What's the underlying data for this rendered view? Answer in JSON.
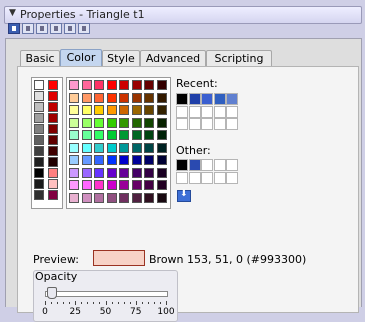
{
  "window": {
    "title": "Properties - Triangle t1"
  },
  "toolbar_icons": [
    "properties-view-icon",
    "triangle-icon",
    "grid-icon",
    "image-icon",
    "align-icon",
    "brush-icon"
  ],
  "tabs": [
    {
      "label": "Basic",
      "active": false
    },
    {
      "label": "Color",
      "active": true
    },
    {
      "label": "Style",
      "active": false
    },
    {
      "label": "Advanced",
      "active": false
    },
    {
      "label": "Scripting",
      "active": false
    }
  ],
  "palette": {
    "recent_label": "Recent:",
    "other_label": "Other:",
    "gray_column": [
      "#ffffff",
      "#e0e0e0",
      "#c0c0c0",
      "#a0a0a0",
      "#808080",
      "#606060",
      "#404040",
      "#202020",
      "#000000",
      "#1a1a1a",
      "#303030"
    ],
    "red_column": [
      "#ff0000",
      "#e00000",
      "#c00000",
      "#a00000",
      "#800000",
      "#600000",
      "#400000",
      "#200000",
      "#ff8080",
      "#ffc0c0",
      "#800040"
    ],
    "grid_colors": [
      [
        "#ff99cc",
        "#ff6699",
        "#ff3366",
        "#ff0000",
        "#cc0000",
        "#990000",
        "#660000",
        "#330000"
      ],
      [
        "#ffcc99",
        "#ff9966",
        "#ff6633",
        "#ff3300",
        "#cc3300",
        "#993300",
        "#663300",
        "#331a00"
      ],
      [
        "#ffff99",
        "#ffff66",
        "#ffcc00",
        "#ff9900",
        "#cc6600",
        "#996600",
        "#664400",
        "#332200"
      ],
      [
        "#ccff99",
        "#99ff66",
        "#66ff33",
        "#33cc00",
        "#339900",
        "#226600",
        "#114400",
        "#082200"
      ],
      [
        "#99ffcc",
        "#66ff99",
        "#33ff66",
        "#00cc33",
        "#009933",
        "#006622",
        "#004411",
        "#002208"
      ],
      [
        "#99ffff",
        "#66ffff",
        "#33cccc",
        "#00cccc",
        "#009999",
        "#006666",
        "#004444",
        "#002222"
      ],
      [
        "#99ccff",
        "#6699ff",
        "#3366ff",
        "#0033ff",
        "#0000cc",
        "#000099",
        "#000066",
        "#000033"
      ],
      [
        "#cc99ff",
        "#9966ff",
        "#6633ff",
        "#6600cc",
        "#660099",
        "#440066",
        "#330044",
        "#1a0022"
      ],
      [
        "#ff99ff",
        "#ff66ff",
        "#ff33cc",
        "#cc00cc",
        "#990099",
        "#660066",
        "#440044",
        "#220022"
      ],
      [
        "#e8b0d0",
        "#d090c0",
        "#b070a0",
        "#905080",
        "#703060",
        "#502040",
        "#301020",
        "#180810"
      ]
    ],
    "recent_colors": [
      "#000000",
      "#1f3fa8",
      "#3a5fd0",
      "#2f5fc0",
      "#6080d0"
    ],
    "other_colors": [
      "#000000",
      "#2a4ab0"
    ]
  },
  "preview": {
    "label": "Preview:",
    "color": "#f7d2c6",
    "description": "Brown 153, 51, 0 (#993300)"
  },
  "opacity": {
    "label": "Opacity",
    "value": 0.06,
    "ticks": [
      "0",
      "25",
      "50",
      "75",
      "100"
    ]
  }
}
